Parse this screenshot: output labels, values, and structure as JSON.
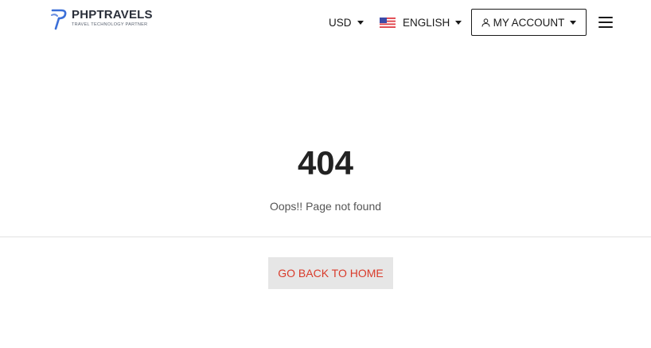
{
  "header": {
    "logo": {
      "name": "PHPTRAVELS",
      "tagline": "TRAVEL TECHNOLOGY PARTNER",
      "brand_color": "#3b6fd8"
    },
    "currency": {
      "label": "USD",
      "icon": "chevron-down-icon"
    },
    "language": {
      "label": "ENGLISH",
      "flag": "us-flag-icon",
      "icon": "chevron-down-icon"
    },
    "account": {
      "label": "MY ACCOUNT",
      "icon": "user-icon"
    },
    "menu_icon": "hamburger-menu-icon"
  },
  "main": {
    "error_code": "404",
    "message": "Oops!! Page not found",
    "home_button": "GO BACK TO HOME",
    "home_button_color": "#d93b2b"
  }
}
